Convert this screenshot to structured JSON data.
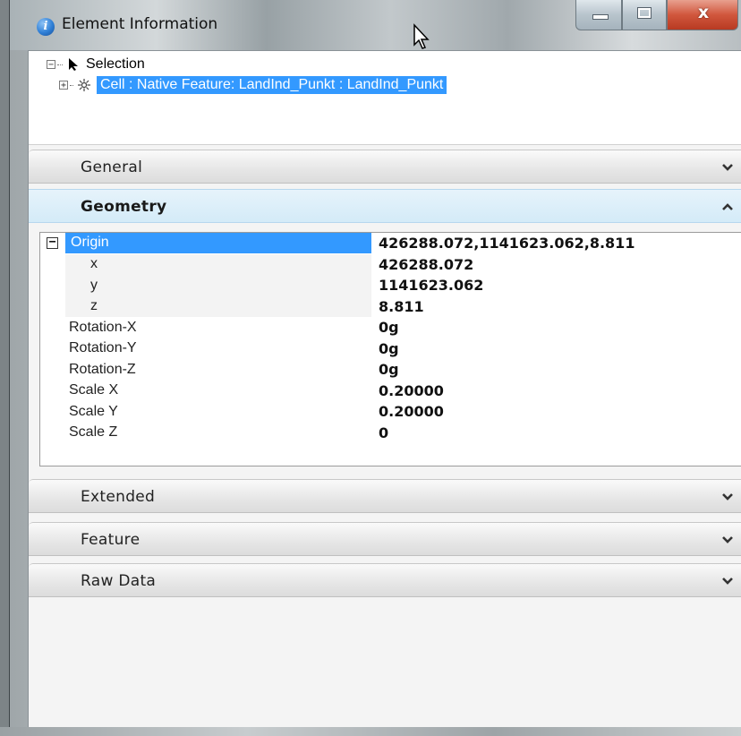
{
  "window": {
    "title": "Element Information",
    "close_glyph": "x"
  },
  "tree": {
    "root_label": "Selection",
    "child_label": "Cell : Native Feature: LandInd_Punkt : LandInd_Punkt",
    "expander_collapse": "−",
    "expander_expand": "+"
  },
  "sections": {
    "general": "General",
    "geometry": "Geometry",
    "extended": "Extended",
    "feature": "Feature",
    "raw_data": "Raw Data"
  },
  "geometry": {
    "origin_expander": "−",
    "rows": [
      {
        "name": "Origin",
        "value": "426288.072,1141623.062,8.811"
      },
      {
        "name": "x",
        "value": "426288.072"
      },
      {
        "name": "y",
        "value": "1141623.062"
      },
      {
        "name": "z",
        "value": "8.811"
      },
      {
        "name": "Rotation-X",
        "value": "0g"
      },
      {
        "name": "Rotation-Y",
        "value": "0g"
      },
      {
        "name": "Rotation-Z",
        "value": "0g"
      },
      {
        "name": "Scale X",
        "value": "0.20000"
      },
      {
        "name": "Scale Y",
        "value": "0.20000"
      },
      {
        "name": "Scale Z",
        "value": "0"
      }
    ]
  },
  "colors": {
    "selection": "#3399ff",
    "active_section": "#d4ebf8",
    "close_button": "#d1573d"
  },
  "icons": {
    "title": "info-icon",
    "selection": "arrow-pointer-icon",
    "cell": "cell-star-icon",
    "collapsed": "chevron-down-icon",
    "expanded": "chevron-up-icon"
  }
}
